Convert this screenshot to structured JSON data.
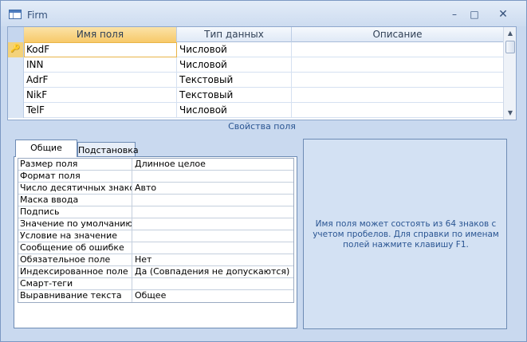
{
  "window": {
    "title": "Firm",
    "minimize": "–",
    "maximize": "□",
    "close": "✕"
  },
  "grid": {
    "headers": {
      "name": "Имя поля",
      "type": "Тип данных",
      "description": "Описание"
    },
    "rows": [
      {
        "name": "KodF",
        "type": "Числовой",
        "description": "",
        "primary_key": true
      },
      {
        "name": "INN",
        "type": "Числовой",
        "description": ""
      },
      {
        "name": "AdrF",
        "type": "Текстовый",
        "description": ""
      },
      {
        "name": "NikF",
        "type": "Текстовый",
        "description": ""
      },
      {
        "name": "TelF",
        "type": "Числовой",
        "description": ""
      }
    ]
  },
  "properties": {
    "caption": "Свойства поля",
    "tabs": {
      "general": "Общие",
      "lookup": "Подстановка"
    },
    "rows": [
      {
        "label": "Размер поля",
        "value": "Длинное целое"
      },
      {
        "label": "Формат поля",
        "value": ""
      },
      {
        "label": "Число десятичных знаков",
        "value": "Авто"
      },
      {
        "label": "Маска ввода",
        "value": ""
      },
      {
        "label": "Подпись",
        "value": ""
      },
      {
        "label": "Значение по умолчанию",
        "value": ""
      },
      {
        "label": "Условие на значение",
        "value": ""
      },
      {
        "label": "Сообщение об ошибке",
        "value": ""
      },
      {
        "label": "Обязательное поле",
        "value": "Нет"
      },
      {
        "label": "Индексированное поле",
        "value": "Да (Совпадения не допускаются)"
      },
      {
        "label": "Смарт-теги",
        "value": ""
      },
      {
        "label": "Выравнивание текста",
        "value": "Общее"
      }
    ],
    "hint": "Имя поля может состоять из 64 знаков с учетом пробелов.  Для справки по именам полей нажмите клавишу F1."
  }
}
